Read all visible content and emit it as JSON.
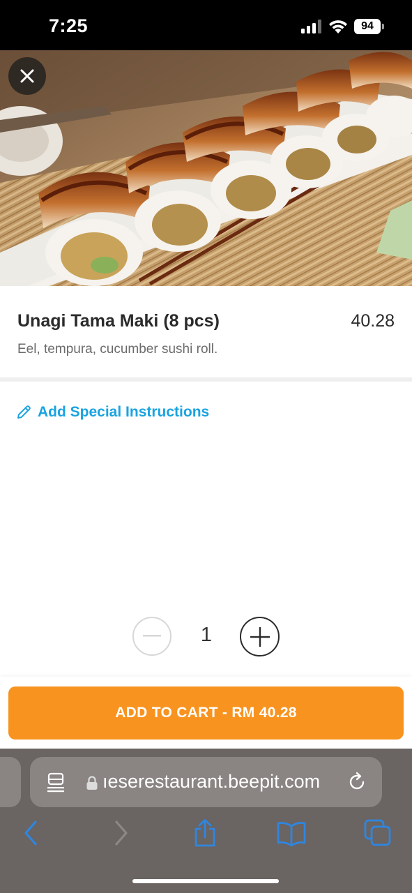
{
  "status_bar": {
    "time": "7:25",
    "battery": "94"
  },
  "hero": {
    "image": "unagi-maki-photo"
  },
  "product": {
    "name": "Unagi Tama Maki (8 pcs)",
    "price": "40.28",
    "description": "Eel, tempura, cucumber sushi roll."
  },
  "special_instructions": {
    "label": "Add Special Instructions",
    "icon": "pencil-icon"
  },
  "quantity": {
    "value": "1"
  },
  "cart": {
    "button_label": "ADD TO CART - RM 40.28"
  },
  "browser": {
    "url": "ıeserestaurant.beepit.com"
  },
  "colors": {
    "accent": "#f8931f",
    "link": "#1aa3e0",
    "browser_chrome": "#6a6462",
    "browser_icons": "#2f86e0"
  }
}
